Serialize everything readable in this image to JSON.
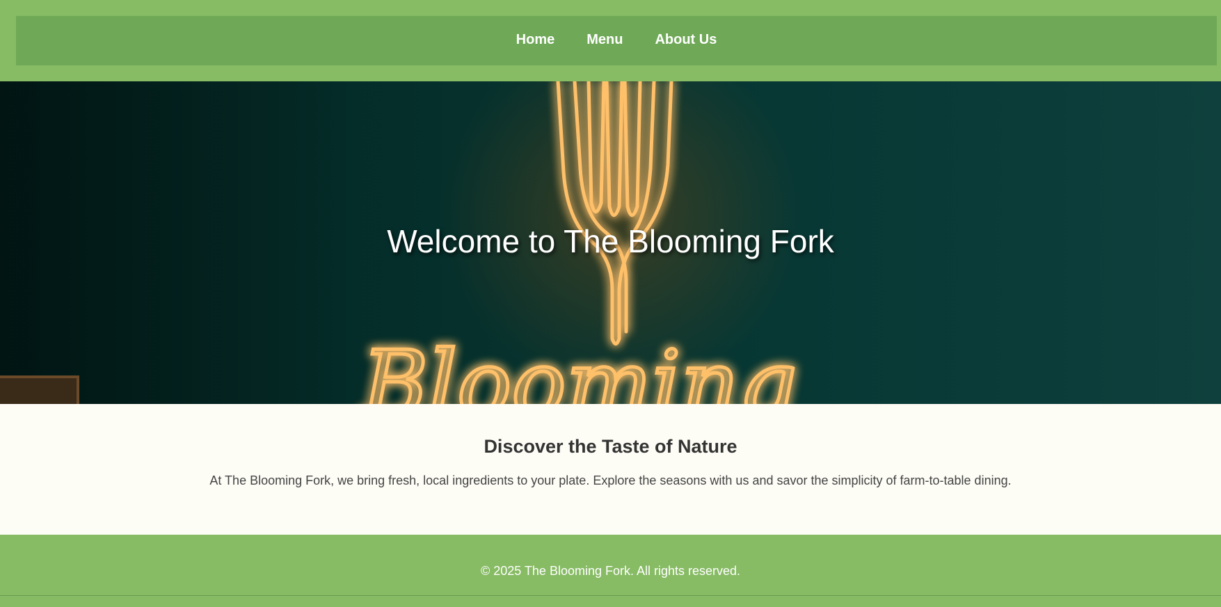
{
  "nav": {
    "items": [
      {
        "label": "Home"
      },
      {
        "label": "Menu"
      },
      {
        "label": "About Us"
      }
    ]
  },
  "hero": {
    "title": "Welcome to The Blooming Fork",
    "sign_text": "Blooming"
  },
  "about": {
    "heading": "Discover the Taste of Nature",
    "body": "At The Blooming Fork, we bring fresh, local ingredients to your plate. Explore the seasons with us and savor the simplicity of farm-to-table dining."
  },
  "footer": {
    "copyright": "© 2025 The Blooming Fork. All rights reserved."
  },
  "colors": {
    "header_bg": "#87bb64",
    "nav_bg": "#6fa957",
    "content_bg": "#fdfcf5",
    "neon": "#ffb347"
  }
}
